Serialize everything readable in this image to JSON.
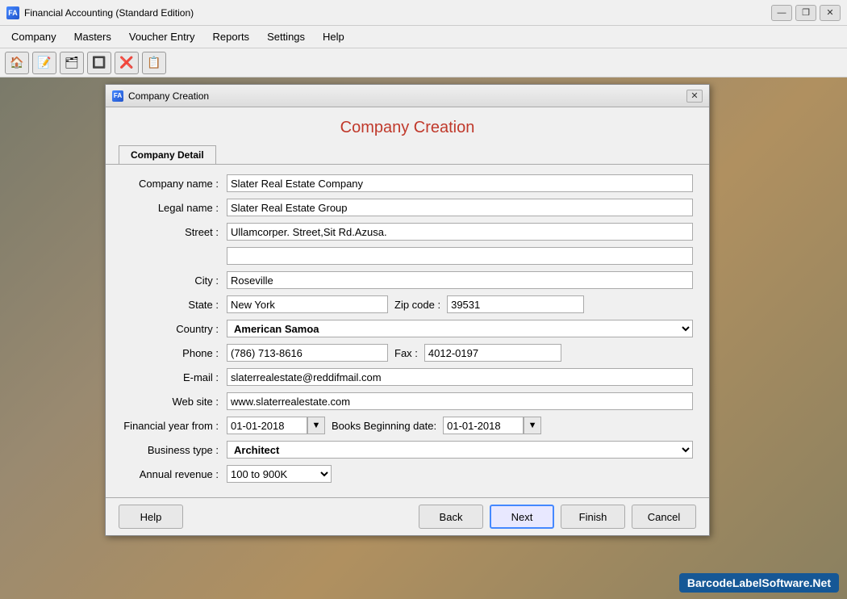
{
  "app": {
    "title": "Financial Accounting (Standard Edition)",
    "icon_label": "FA"
  },
  "title_controls": {
    "minimize": "—",
    "maximize": "❐",
    "close": "✕"
  },
  "menu": {
    "items": [
      {
        "label": "Company"
      },
      {
        "label": "Masters"
      },
      {
        "label": "Voucher Entry"
      },
      {
        "label": "Reports"
      },
      {
        "label": "Settings"
      },
      {
        "label": "Help"
      }
    ]
  },
  "toolbar": {
    "buttons": [
      "🏠",
      "📝",
      "🗂",
      "🔲",
      "❌",
      "📋"
    ]
  },
  "dialog": {
    "title": "Company Creation",
    "heading": "Company Creation",
    "tab_label": "Company Detail",
    "close_btn": "✕"
  },
  "form": {
    "company_name_label": "Company name :",
    "company_name_value": "Slater Real Estate Company",
    "legal_name_label": "Legal name :",
    "legal_name_value": "Slater Real Estate Group",
    "street_label": "Street :",
    "street_line1": "Ullamcorper. Street,Sit Rd.Azusa.",
    "street_line2": "",
    "city_label": "City :",
    "city_value": "Roseville",
    "state_label": "State :",
    "state_value": "New York",
    "zip_label": "Zip code :",
    "zip_value": "39531",
    "country_label": "Country :",
    "country_value": "American Samoa",
    "phone_label": "Phone :",
    "phone_value": "(786) 713-8616",
    "fax_label": "Fax :",
    "fax_value": "4012-0197",
    "email_label": "E-mail :",
    "email_value": "slaterrealestate@reddifmail.com",
    "website_label": "Web site :",
    "website_value": "www.slaterrealestate.com",
    "fy_from_label": "Financial year from :",
    "fy_from_value": "01-01-2018",
    "books_begin_label": "Books Beginning date:",
    "books_begin_value": "01-01-2018",
    "business_type_label": "Business type :",
    "business_type_value": "Architect",
    "annual_revenue_label": "Annual revenue :",
    "annual_revenue_value": "100 to 900K"
  },
  "footer": {
    "help_label": "Help",
    "back_label": "Back",
    "next_label": "Next",
    "finish_label": "Finish",
    "cancel_label": "Cancel"
  },
  "watermark": "BarcodeLabelSoftware.Net"
}
